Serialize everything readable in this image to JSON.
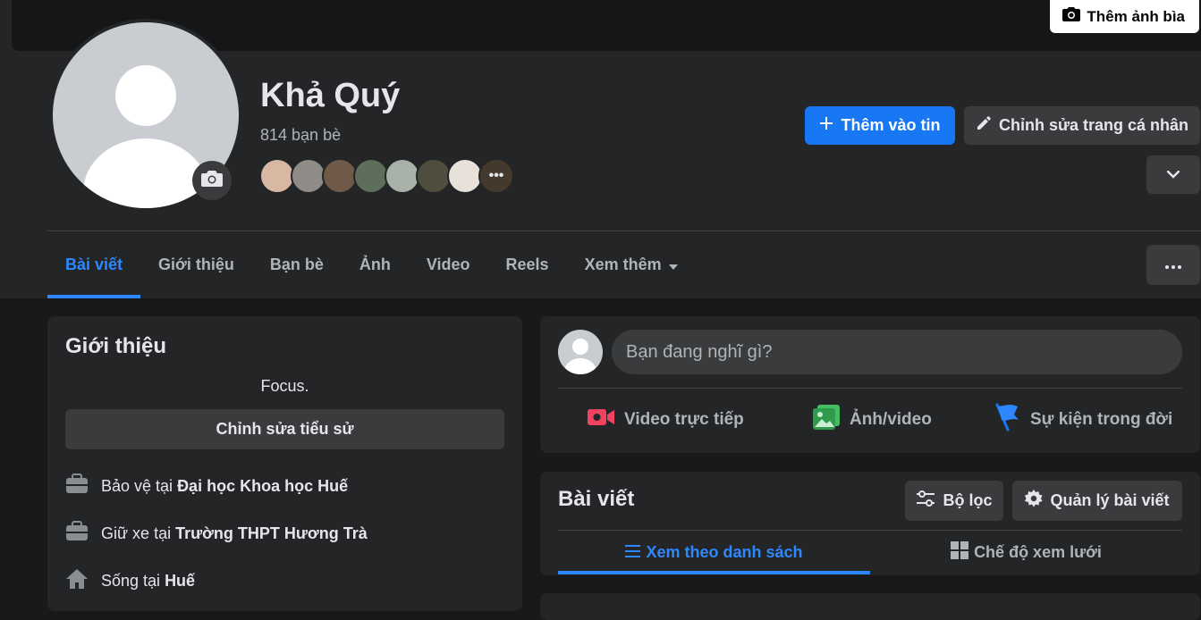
{
  "cover": {
    "add_cover_label": "Thêm ảnh bìa"
  },
  "profile": {
    "name": "Khả Quý",
    "friends_count": "814 bạn bè",
    "friend_avatar_colors": [
      "#d9b8a3",
      "#8f8b86",
      "#6f5a4a",
      "#5d6e5a",
      "#a9b2a8",
      "#4e4d3e",
      "#e8e1da",
      "#6b5646"
    ],
    "more_friends_icon": "ellipsis-icon"
  },
  "actions": {
    "add_to_story": "Thêm vào tin",
    "edit_profile": "Chỉnh sửa trang cá nhân"
  },
  "tabs": [
    {
      "label": "Bài viết",
      "active": true
    },
    {
      "label": "Giới thiệu"
    },
    {
      "label": "Bạn bè"
    },
    {
      "label": "Ảnh"
    },
    {
      "label": "Video"
    },
    {
      "label": "Reels"
    },
    {
      "label": "Xem thêm"
    }
  ],
  "intro": {
    "title": "Giới thiệu",
    "bio": "Focus.",
    "edit_bio": "Chỉnh sửa tiểu sử",
    "items": [
      {
        "prefix": "Bảo vệ tại ",
        "bold": "Đại học Khoa học Huế",
        "icon": "briefcase-icon"
      },
      {
        "prefix": "Giữ xe tại ",
        "bold": "Trường THPT Hương Trà",
        "icon": "briefcase-icon"
      },
      {
        "prefix": "Sống tại ",
        "bold": "Huế",
        "icon": "home-icon"
      }
    ]
  },
  "composer": {
    "placeholder": "Bạn đang nghĩ gì?",
    "live_video": "Video trực tiếp",
    "photo_video": "Ảnh/video",
    "life_event": "Sự kiện trong đời"
  },
  "posts": {
    "title": "Bài viết",
    "filter": "Bộ lọc",
    "manage": "Quản lý bài viết",
    "list_view": "Xem theo danh sách",
    "grid_view": "Chế độ xem lưới"
  },
  "colors": {
    "accent": "#1877f2",
    "accent_text": "#2d88ff",
    "background": "#18191a",
    "card": "#242526",
    "button": "#3a3b3c",
    "live_red": "#f3425f",
    "photo_green": "#45bd62",
    "event_blue": "#1877f2"
  }
}
